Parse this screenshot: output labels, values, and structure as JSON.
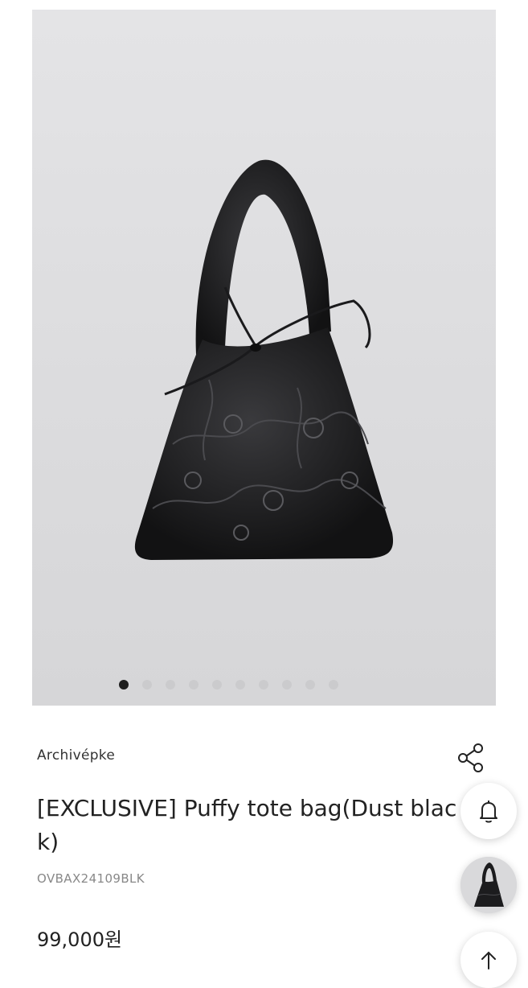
{
  "gallery": {
    "image_alt": "Black quilted puffy tote bag with floral embroidery and bow tie",
    "slide_count": 10,
    "active_slide": 1
  },
  "product": {
    "brand": "Archivépke",
    "title": "[EXCLUSIVE] Puffy tote bag(Dust black)",
    "code": "OVBAX24109BLK",
    "price": "99,000원"
  },
  "icons": {
    "share": "share-icon",
    "bell": "bell-icon",
    "scroll_top": "arrow-up-icon",
    "recent_item": "product-thumbnail"
  },
  "colors": {
    "bag": "#1c1c1e",
    "background": "#dcdcde",
    "dot_active": "#1e1e1e",
    "dot_inactive": "#cbcbcd"
  }
}
